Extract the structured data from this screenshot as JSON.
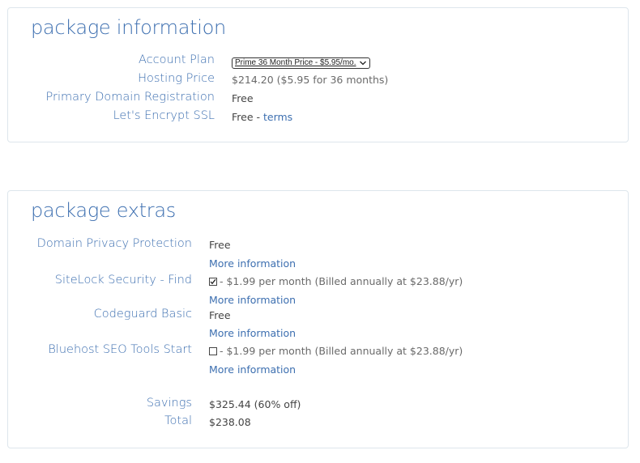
{
  "package_information": {
    "title": "package information",
    "account_plan": {
      "label": "Account Plan",
      "selected": "Prime 36 Month Price - $5.95/mo."
    },
    "hosting_price": {
      "label": "Hosting Price",
      "value": "$214.20  ($5.95 for 36 months)"
    },
    "domain_registration": {
      "label": "Primary Domain Registration",
      "value": "Free"
    },
    "ssl": {
      "label": "Let's Encrypt SSL",
      "value": "Free - ",
      "link": "terms"
    }
  },
  "package_extras": {
    "title": "package extras",
    "items": [
      {
        "label": "Domain Privacy Protection",
        "value": "Free",
        "more": "More information"
      },
      {
        "label": "SiteLock Security - Find",
        "checked": true,
        "value": "- $1.99 per month (Billed annually at $23.88/yr)",
        "more": "More information"
      },
      {
        "label": "Codeguard Basic",
        "value": "Free",
        "more": "More information"
      },
      {
        "label": "Bluehost SEO Tools Start",
        "checked": false,
        "value": "- $1.99 per month (Billed annually at $23.88/yr)",
        "more": "More information"
      }
    ],
    "savings": {
      "label": "Savings",
      "value": "$325.44 (60% off)"
    },
    "total": {
      "label": "Total",
      "value": "$238.08"
    }
  }
}
